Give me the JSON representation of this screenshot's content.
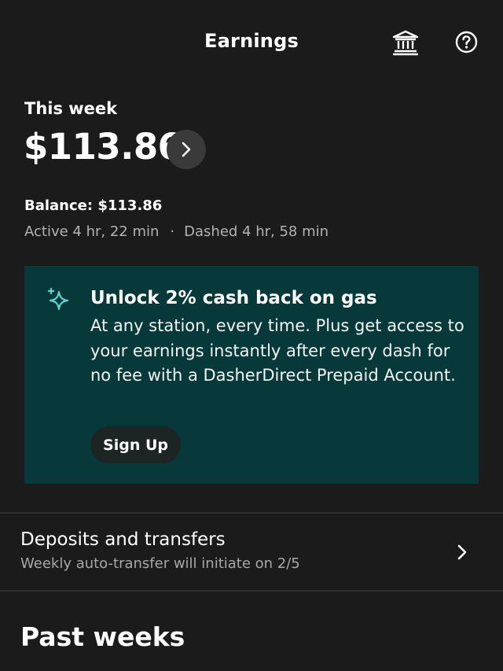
{
  "header": {
    "title": "Earnings",
    "bank_icon": "bank-icon",
    "help_icon": "help-circle-icon"
  },
  "summary": {
    "label": "This week",
    "amount": "$113.86",
    "details_icon": "chevron-right-icon",
    "balance": "Balance: $113.86",
    "active_time": "Active 4 hr, 22 min",
    "separator": "·",
    "dashed_time": "Dashed 4 hr, 58 min"
  },
  "promo": {
    "icon": "sparkle-icon",
    "title": "Unlock 2% cash back on gas",
    "body": "At any station, every time. Plus get access to your earnings instantly after every dash for no fee with a DasherDirect Prepaid Account.",
    "button_label": "Sign Up",
    "background_color": "#07393a",
    "accent_color": "#5fd4cf"
  },
  "deposits": {
    "title": "Deposits and transfers",
    "subtitle": "Weekly auto-transfer will initiate on 2/5",
    "chevron_icon": "chevron-right-icon"
  },
  "past_weeks": {
    "title": "Past weeks"
  },
  "colors": {
    "background": "#1b1b1b",
    "text_primary": "#ffffff",
    "text_secondary": "#b3b3b3"
  }
}
